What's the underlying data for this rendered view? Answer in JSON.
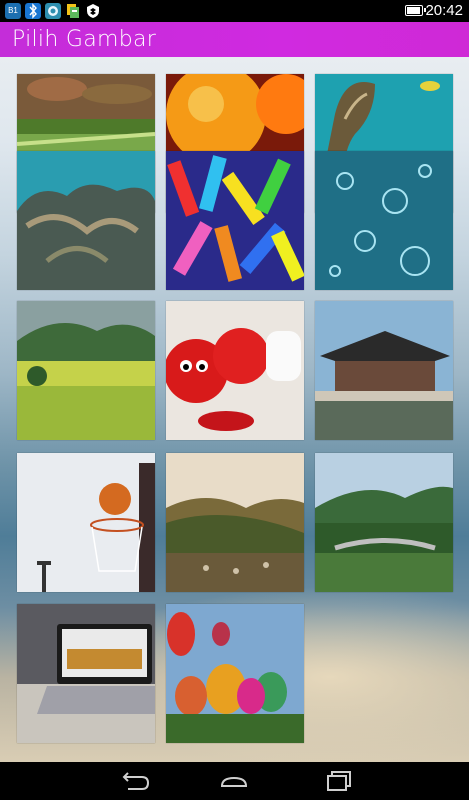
{
  "status_bar": {
    "time": "20:42",
    "icons": [
      "b1-icon",
      "bluetooth-icon",
      "app-notification-icon",
      "files-icon",
      "vpn-shield-icon"
    ],
    "battery_level": 0.8
  },
  "app_bar": {
    "title": "Pilih Gambar"
  },
  "gallery": {
    "items": [
      {
        "name": "grass-closeup"
      },
      {
        "name": "fruit-water-drops"
      },
      {
        "name": "sea-turtle"
      },
      {
        "name": "coral-reef"
      },
      {
        "name": "clothespins"
      },
      {
        "name": "water-bubbles"
      },
      {
        "name": "green-fields"
      },
      {
        "name": "sad-tomato"
      },
      {
        "name": "korean-palace"
      },
      {
        "name": "basketball-hoop"
      },
      {
        "name": "valley-village"
      },
      {
        "name": "garden-bridge"
      },
      {
        "name": "laptop-desk"
      },
      {
        "name": "hot-air-balloons"
      }
    ]
  },
  "nav_bar": {
    "buttons": [
      "back-icon",
      "home-icon",
      "recents-icon"
    ]
  }
}
